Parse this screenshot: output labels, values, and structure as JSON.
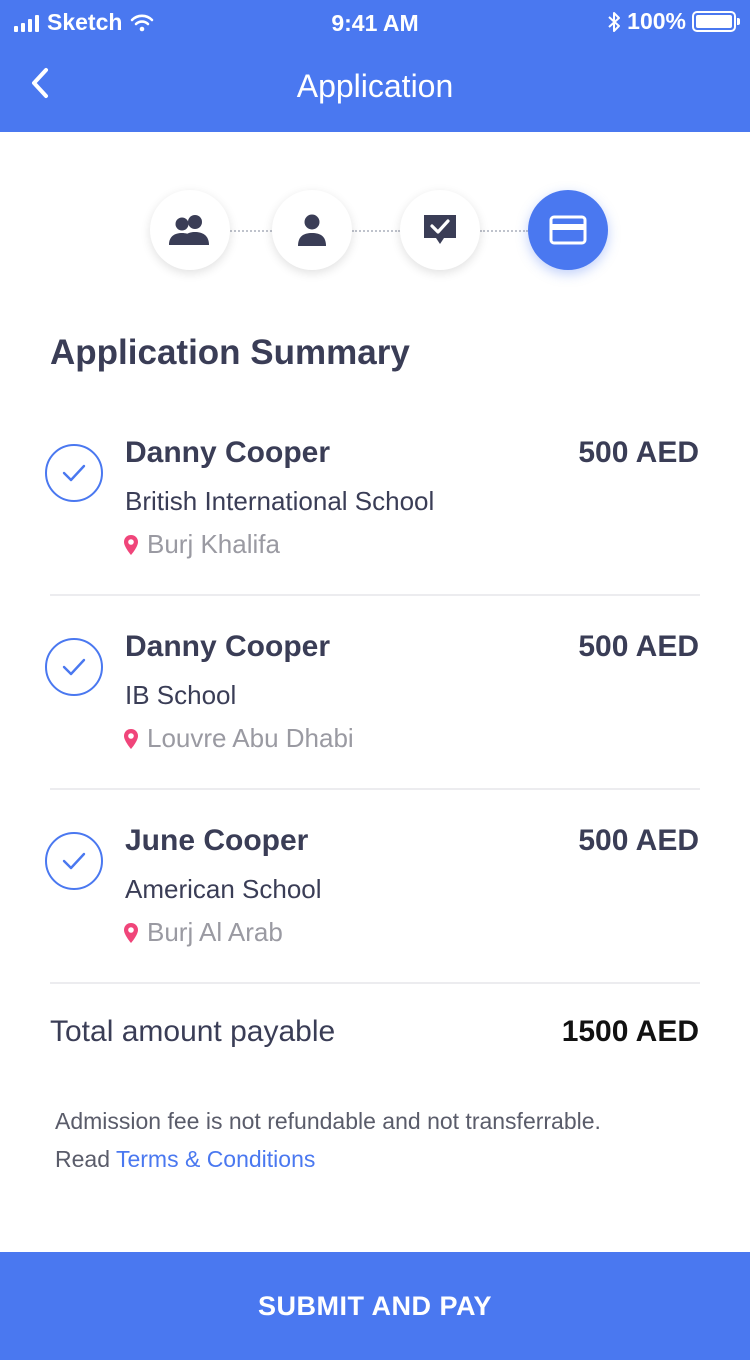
{
  "status_bar": {
    "carrier": "Sketch",
    "time": "9:41 AM",
    "battery": "100%"
  },
  "nav": {
    "title": "Application",
    "back_icon": "chevron-left-icon"
  },
  "steps": [
    {
      "icon": "group-icon",
      "active": false
    },
    {
      "icon": "person-icon",
      "active": false
    },
    {
      "icon": "review-check-icon",
      "active": false
    },
    {
      "icon": "card-icon",
      "active": true
    }
  ],
  "summary": {
    "title": "Application Summary",
    "items": [
      {
        "name": "Danny Cooper",
        "price": "500 AED",
        "school": "British International School",
        "location": "Burj Khalifa"
      },
      {
        "name": "Danny Cooper",
        "price": "500 AED",
        "school": "IB School",
        "location": "Louvre Abu Dhabi"
      },
      {
        "name": "June Cooper",
        "price": "500 AED",
        "school": "American School",
        "location": "Burj Al Arab"
      }
    ],
    "total_label": "Total amount payable",
    "total_value": "1500 AED"
  },
  "note": {
    "line1": "Admission fee is not refundable and not transferrable.",
    "read": "Read",
    "link": "Terms & Conditions"
  },
  "submit_label": "SUBMIT AND PAY",
  "colors": {
    "accent": "#4a78f0",
    "text": "#3a3d56",
    "muted": "#9a9aa2",
    "pin": "#f0457a"
  }
}
